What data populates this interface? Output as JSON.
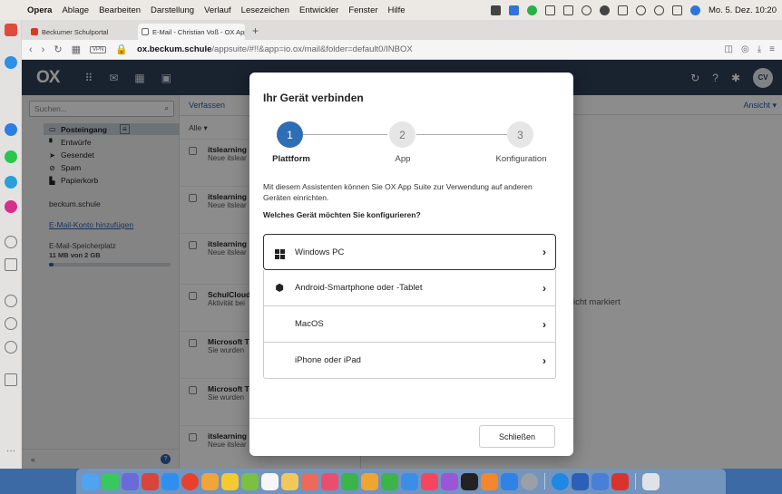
{
  "menubar": {
    "app": "Opera",
    "items": [
      "Ablage",
      "Bearbeiten",
      "Darstellung",
      "Verlauf",
      "Lesezeichen",
      "Entwickler",
      "Fenster",
      "Hilfe"
    ],
    "clock": "Mo. 5. Dez. 10:20"
  },
  "browser": {
    "tabs": [
      {
        "label": "Beckumer Schulportal"
      },
      {
        "label": "E-Mail - Christian Voß - OX App"
      }
    ],
    "new_tab": "+",
    "vpn_badge": "VPN",
    "url_host": "ox.beckum.schule",
    "url_path": "/appsuite/#!!&app=io.ox/mail&folder=default0/INBOX"
  },
  "ox": {
    "logo": "OX",
    "avatar_initials": "CV"
  },
  "folders": {
    "search_placeholder": "Suchen...",
    "items": [
      {
        "label": "Posteingang",
        "icon": "inbox-icon"
      },
      {
        "label": "Entwürfe",
        "icon": "draft-icon"
      },
      {
        "label": "Gesendet",
        "icon": "send-icon"
      },
      {
        "label": "Spam",
        "icon": "spam-icon"
      },
      {
        "label": "Papierkorb",
        "icon": "trash-icon"
      }
    ],
    "account": "beckum.schule",
    "add_account": "E-Mail-Konto hinzufügen",
    "quota_label": "E-Mail-Speicherplatz",
    "quota_value": "11 MB von 2 GB",
    "quota_fraction": 0.0055,
    "collapse": "«",
    "help": "?"
  },
  "list": {
    "compose": "Verfassen",
    "filter": "Alle ▾",
    "items": [
      {
        "from": "itslearning",
        "preview": "Neue itslear"
      },
      {
        "from": "itslearning",
        "preview": "Neue itslear"
      },
      {
        "from": "itslearning",
        "preview": "Neue itslear"
      },
      {
        "from": "SchulCloud",
        "preview": "Aktivität bei"
      },
      {
        "from": "Microsoft T",
        "preview": "Sie wurden"
      },
      {
        "from": "Microsoft T",
        "preview": "Sie wurden"
      },
      {
        "from": "itslearning",
        "preview": "Neue itslear"
      }
    ]
  },
  "reading": {
    "view_label": "Ansicht ▾",
    "empty_text": "icht markiert"
  },
  "dialog": {
    "title": "Ihr Gerät verbinden",
    "steps": [
      {
        "num": "1",
        "label": "Plattform"
      },
      {
        "num": "2",
        "label": "App"
      },
      {
        "num": "3",
        "label": "Konfiguration"
      }
    ],
    "intro": "Mit diesem Assistenten können Sie OX App Suite zur Verwendung auf anderen Geräten einrichten.",
    "question": "Welches Gerät möchten Sie konfigurieren?",
    "devices": [
      {
        "label": "Windows PC",
        "icon": "windows-icon"
      },
      {
        "label": "Android-Smartphone oder -Tablet",
        "icon": "android-icon"
      },
      {
        "label": "MacOS",
        "icon": "apple-icon"
      },
      {
        "label": "iPhone oder iPad",
        "icon": "apple-icon"
      }
    ],
    "close_label": "Schließen"
  },
  "colors": {
    "ox_header": "#2f3f56",
    "accent": "#2f6db5",
    "link": "#2a5ea8"
  }
}
